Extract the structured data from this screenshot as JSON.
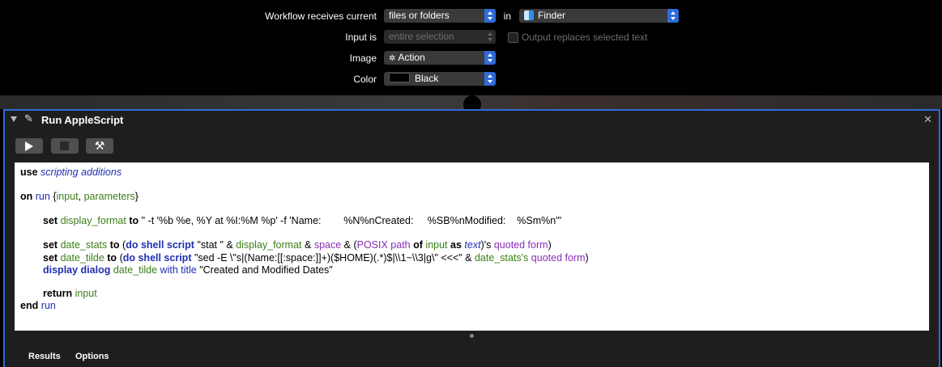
{
  "workflow": {
    "receives_label": "Workflow receives current",
    "receives_value": "files or folders",
    "in_label": "in",
    "in_value": "Finder",
    "input_is_label": "Input is",
    "input_is_value": "entire selection",
    "output_replaces_label": "Output replaces selected text",
    "image_label": "Image",
    "image_value": "Action",
    "color_label": "Color",
    "color_value": "Black"
  },
  "action": {
    "title": "Run AppleScript",
    "tabs": [
      "Results",
      "Options"
    ]
  },
  "script": {
    "l1": {
      "kw": "use",
      "cls": "scripting additions"
    },
    "l2": {
      "on": "on",
      "run": "run",
      "o": " {",
      "p1": "input",
      "c": ", ",
      "p2": "parameters",
      "e": "}"
    },
    "l3": {
      "set": "set",
      "var": "display_format",
      "to": "to",
      "str": "\" -t '%b %e, %Y at %I:%M %p' -f 'Name:        %N%nCreated:     %SB%nModified:    %Sm%n'\""
    },
    "l4": {
      "set": "set",
      "var": "date_stats",
      "to": "to",
      "p": "(",
      "do": "do shell script",
      "s1": "\"stat \" & ",
      "v1": "display_format",
      "amp1": " & ",
      "sp": "space",
      "amp2": " & (",
      "posix": "POSIX path",
      "of": "of",
      "inp": "input",
      "as": "as",
      "text": "text",
      "tail": ")'s ",
      "qf": "quoted form",
      "close": ")"
    },
    "l5": {
      "set": "set",
      "var": "date_tilde",
      "to": "to",
      "p": "(",
      "do": "do shell script",
      "s1": "\"sed -E \\\"s|(Name:[[:space:]]+)($HOME)(.*)$|\\\\1~\\\\3|g\\\" <<<\" & ",
      "v1": "date_stats's",
      "qf": "quoted form",
      "close": ")"
    },
    "l6": {
      "dd": "display dialog",
      "var": "date_tilde",
      "wt": "with title",
      "str": "\"Created and Modified Dates\""
    },
    "l7": {
      "ret": "return",
      "var": "input"
    },
    "l8": {
      "end": "end",
      "run": "run"
    }
  }
}
